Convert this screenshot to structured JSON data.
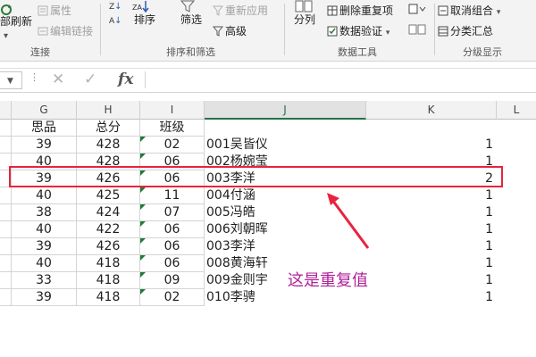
{
  "ribbon": {
    "refresh_label": "部刷新",
    "properties_label": "属性",
    "edit_links_label": "编辑链接",
    "connections_group": "连接",
    "sort_label": "排序",
    "filter_label": "筛选",
    "reapply_label": "重新应用",
    "advanced_label": "高级",
    "sort_filter_group": "排序和筛选",
    "split_label": "分列",
    "remove_dup_label": "删除重复项",
    "validation_label": "数据验证",
    "data_tools_group": "数据工具",
    "ungroup_label": "取消组合",
    "subtotal_label": "分类汇总",
    "outline_group": "分级显示"
  },
  "formula_bar": {
    "fx_label": "fx",
    "value": ""
  },
  "columns": [
    "G",
    "H",
    "I",
    "J",
    "K",
    "L"
  ],
  "headers": {
    "G": "思品",
    "H": "总分",
    "I": "班级"
  },
  "rows": [
    {
      "g": "39",
      "h": "428",
      "i": "02",
      "j": "001吴皆仪",
      "k": "1"
    },
    {
      "g": "40",
      "h": "428",
      "i": "06",
      "j": "002杨婉莹",
      "k": "1"
    },
    {
      "g": "39",
      "h": "426",
      "i": "06",
      "j": "003李洋",
      "k": "2"
    },
    {
      "g": "40",
      "h": "425",
      "i": "11",
      "j": "004付涵",
      "k": "1"
    },
    {
      "g": "38",
      "h": "424",
      "i": "07",
      "j": "005冯皓",
      "k": "1"
    },
    {
      "g": "40",
      "h": "422",
      "i": "06",
      "j": "006刘朝晖",
      "k": "1"
    },
    {
      "g": "39",
      "h": "426",
      "i": "06",
      "j": "003李洋",
      "k": "1"
    },
    {
      "g": "40",
      "h": "418",
      "i": "06",
      "j": "008黄海轩",
      "k": "1"
    },
    {
      "g": "33",
      "h": "418",
      "i": "09",
      "j": "009金则宇",
      "k": "1"
    },
    {
      "g": "39",
      "h": "418",
      "i": "02",
      "j": "010李骋",
      "k": "1"
    }
  ],
  "annotation": {
    "text": "这是重复值",
    "color": "#b0219a",
    "highlight_color": "#e8233f"
  },
  "accent": "#217346"
}
